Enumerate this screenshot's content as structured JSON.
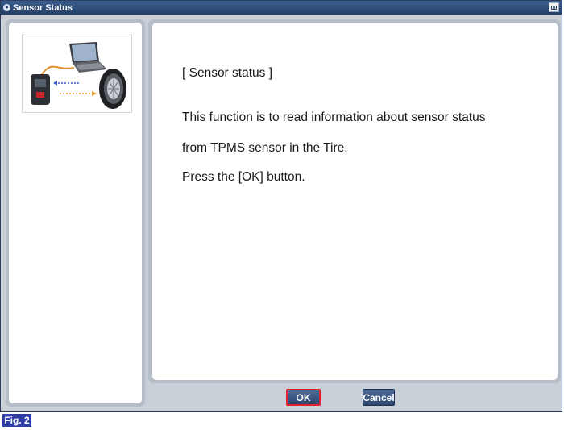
{
  "window": {
    "title": "Sensor Status"
  },
  "content": {
    "heading": "[ Sensor status ]",
    "line1": "This function is to read information about sensor status",
    "line2": "from TPMS sensor in the Tire.",
    "line3": "Press the [OK] button."
  },
  "buttons": {
    "ok_label": "OK",
    "cancel_label": "Cancel"
  },
  "figure_label": "Fig. 2",
  "icons": {
    "title": "info-icon",
    "screenshot": "camera-icon",
    "illustration": "tpms-device-laptop-tire-illustration"
  },
  "colors": {
    "titlebar": "#243f67",
    "panel_frame": "#b5bec8",
    "button": "#2a4470",
    "ok_highlight": "#e0202c",
    "fig_label": "#2f3da8"
  }
}
